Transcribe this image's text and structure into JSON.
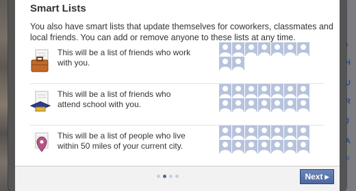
{
  "dialog": {
    "title": "Smart Lists",
    "intro": "You also have smart lists that update themselves for coworkers, classmates and local friends. You can add or remove anyone to these lists at any time.",
    "rows": [
      {
        "icon": "briefcase-icon",
        "text": "This will be a list of friends who work with you.",
        "placeholder_rows": [
          7,
          2
        ]
      },
      {
        "icon": "graduation-cap-icon",
        "text": "This will be a list of friends who attend school with you.",
        "placeholder_rows": [
          7,
          7
        ]
      },
      {
        "icon": "location-pin-icon",
        "text": "This will be a list of people who live within 50 miles of your current city.",
        "placeholder_rows": [
          7,
          7
        ]
      }
    ],
    "pagination": {
      "total": 4,
      "active_index": 1
    },
    "next_label": "Next",
    "colors": {
      "accent": "#4b67a1",
      "placeholder": "#b7c3dc"
    }
  },
  "background": {
    "right_fragments": [
      "pes",
      "H",
      "U",
      "R",
      "J",
      "A",
      "e Su"
    ]
  }
}
